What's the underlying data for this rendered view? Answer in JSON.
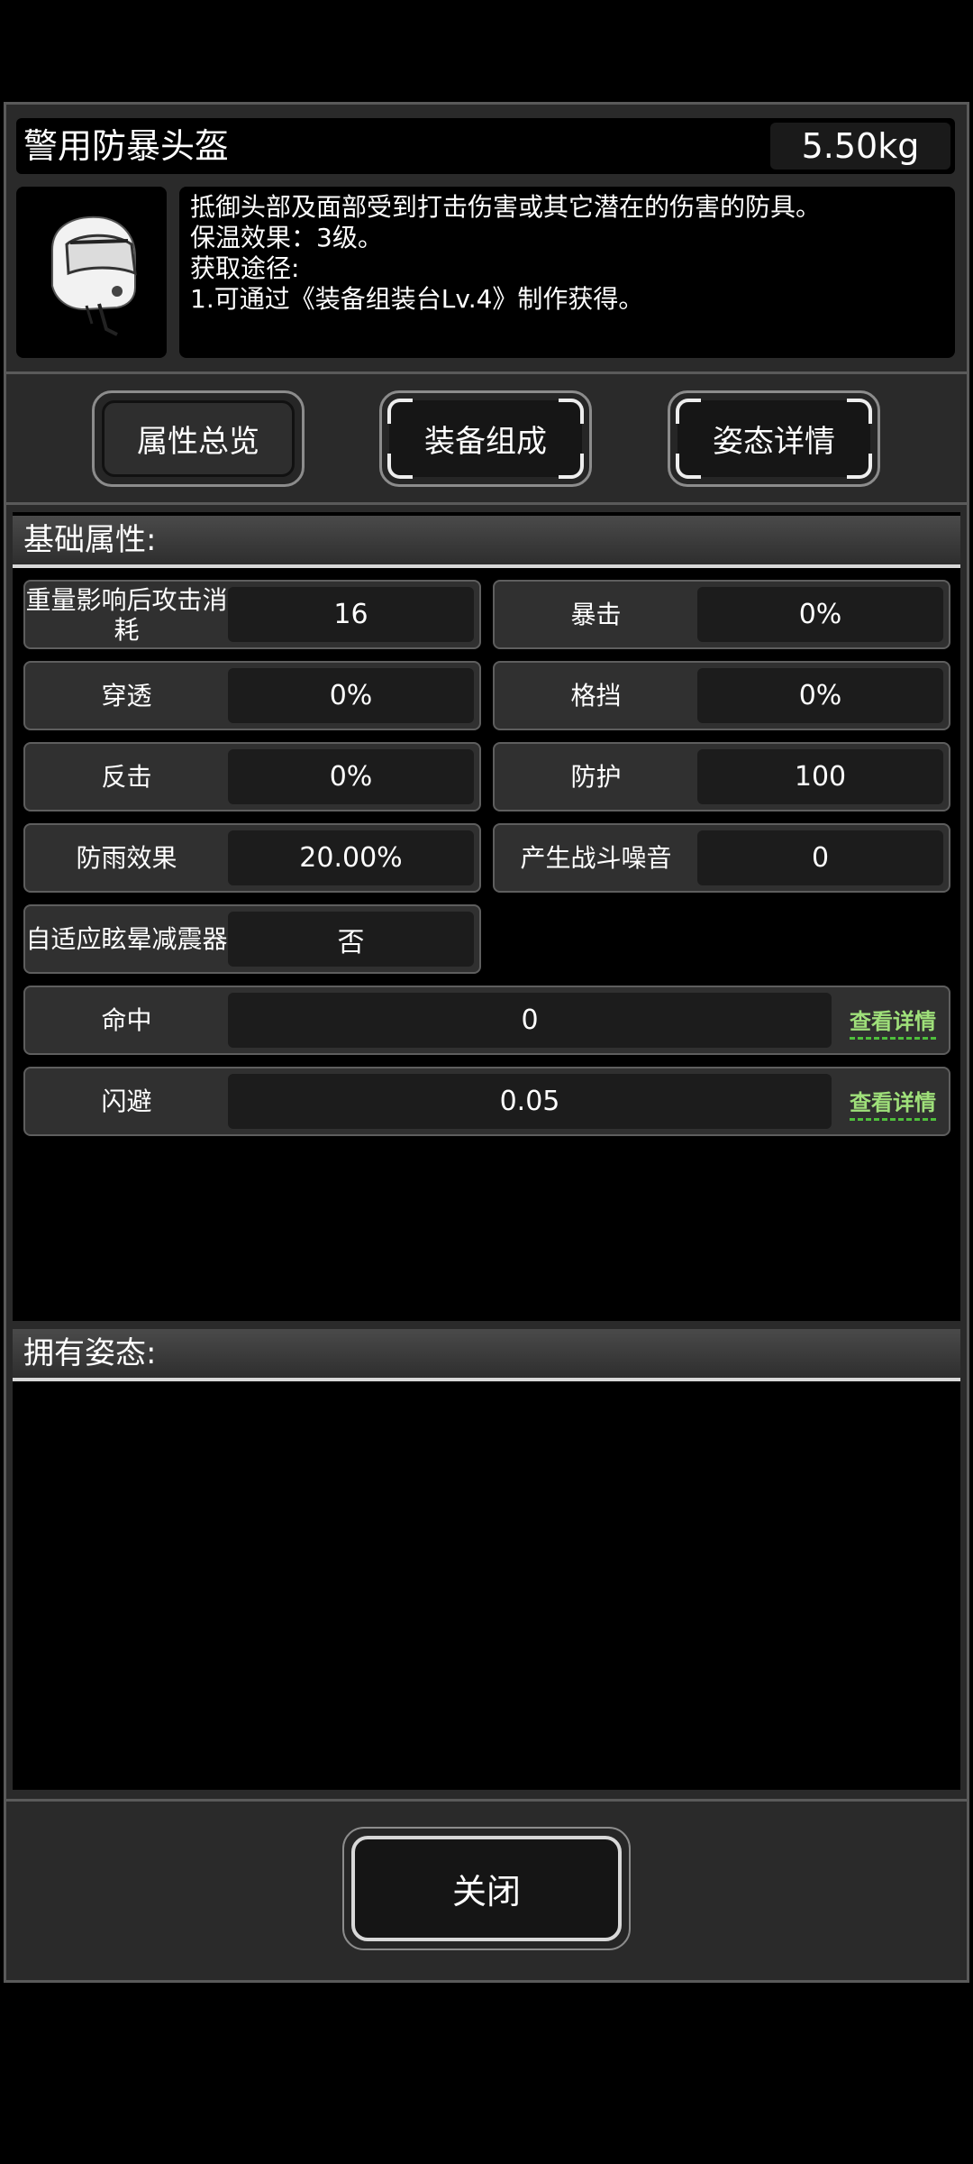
{
  "item": {
    "name": "警用防暴头盔",
    "weight": "5.50kg",
    "description_lines": [
      "抵御头部及面部受到打击伤害或其它潜在的伤害的防具。",
      "保温效果：3级。",
      "获取途径:",
      "1.可通过《装备组装台Lv.4》制作获得。"
    ],
    "icon": "riot-helmet-icon"
  },
  "tabs": [
    {
      "label": "属性总览",
      "active": true
    },
    {
      "label": "装备组成",
      "active": false
    },
    {
      "label": "姿态详情",
      "active": false
    }
  ],
  "base_attributes": {
    "header": "基础属性:",
    "stats": [
      {
        "label": "重量影响后攻击消耗",
        "value": "16"
      },
      {
        "label": "暴击",
        "value": "0%"
      },
      {
        "label": "穿透",
        "value": "0%"
      },
      {
        "label": "格挡",
        "value": "0%"
      },
      {
        "label": "反击",
        "value": "0%"
      },
      {
        "label": "防护",
        "value": "100"
      },
      {
        "label": "防雨效果",
        "value": "20.00%"
      },
      {
        "label": "产生战斗噪音",
        "value": "0"
      },
      {
        "label": "自适应眩晕减震器",
        "value": "否"
      }
    ],
    "detail_stats": [
      {
        "label": "命中",
        "value": "0",
        "link": "查看详情"
      },
      {
        "label": "闪避",
        "value": "0.05",
        "link": "查看详情"
      }
    ]
  },
  "stances": {
    "header": "拥有姿态:"
  },
  "close_label": "关闭",
  "colors": {
    "panel": "#2a2a2a",
    "link_green": "#9fe07a"
  }
}
